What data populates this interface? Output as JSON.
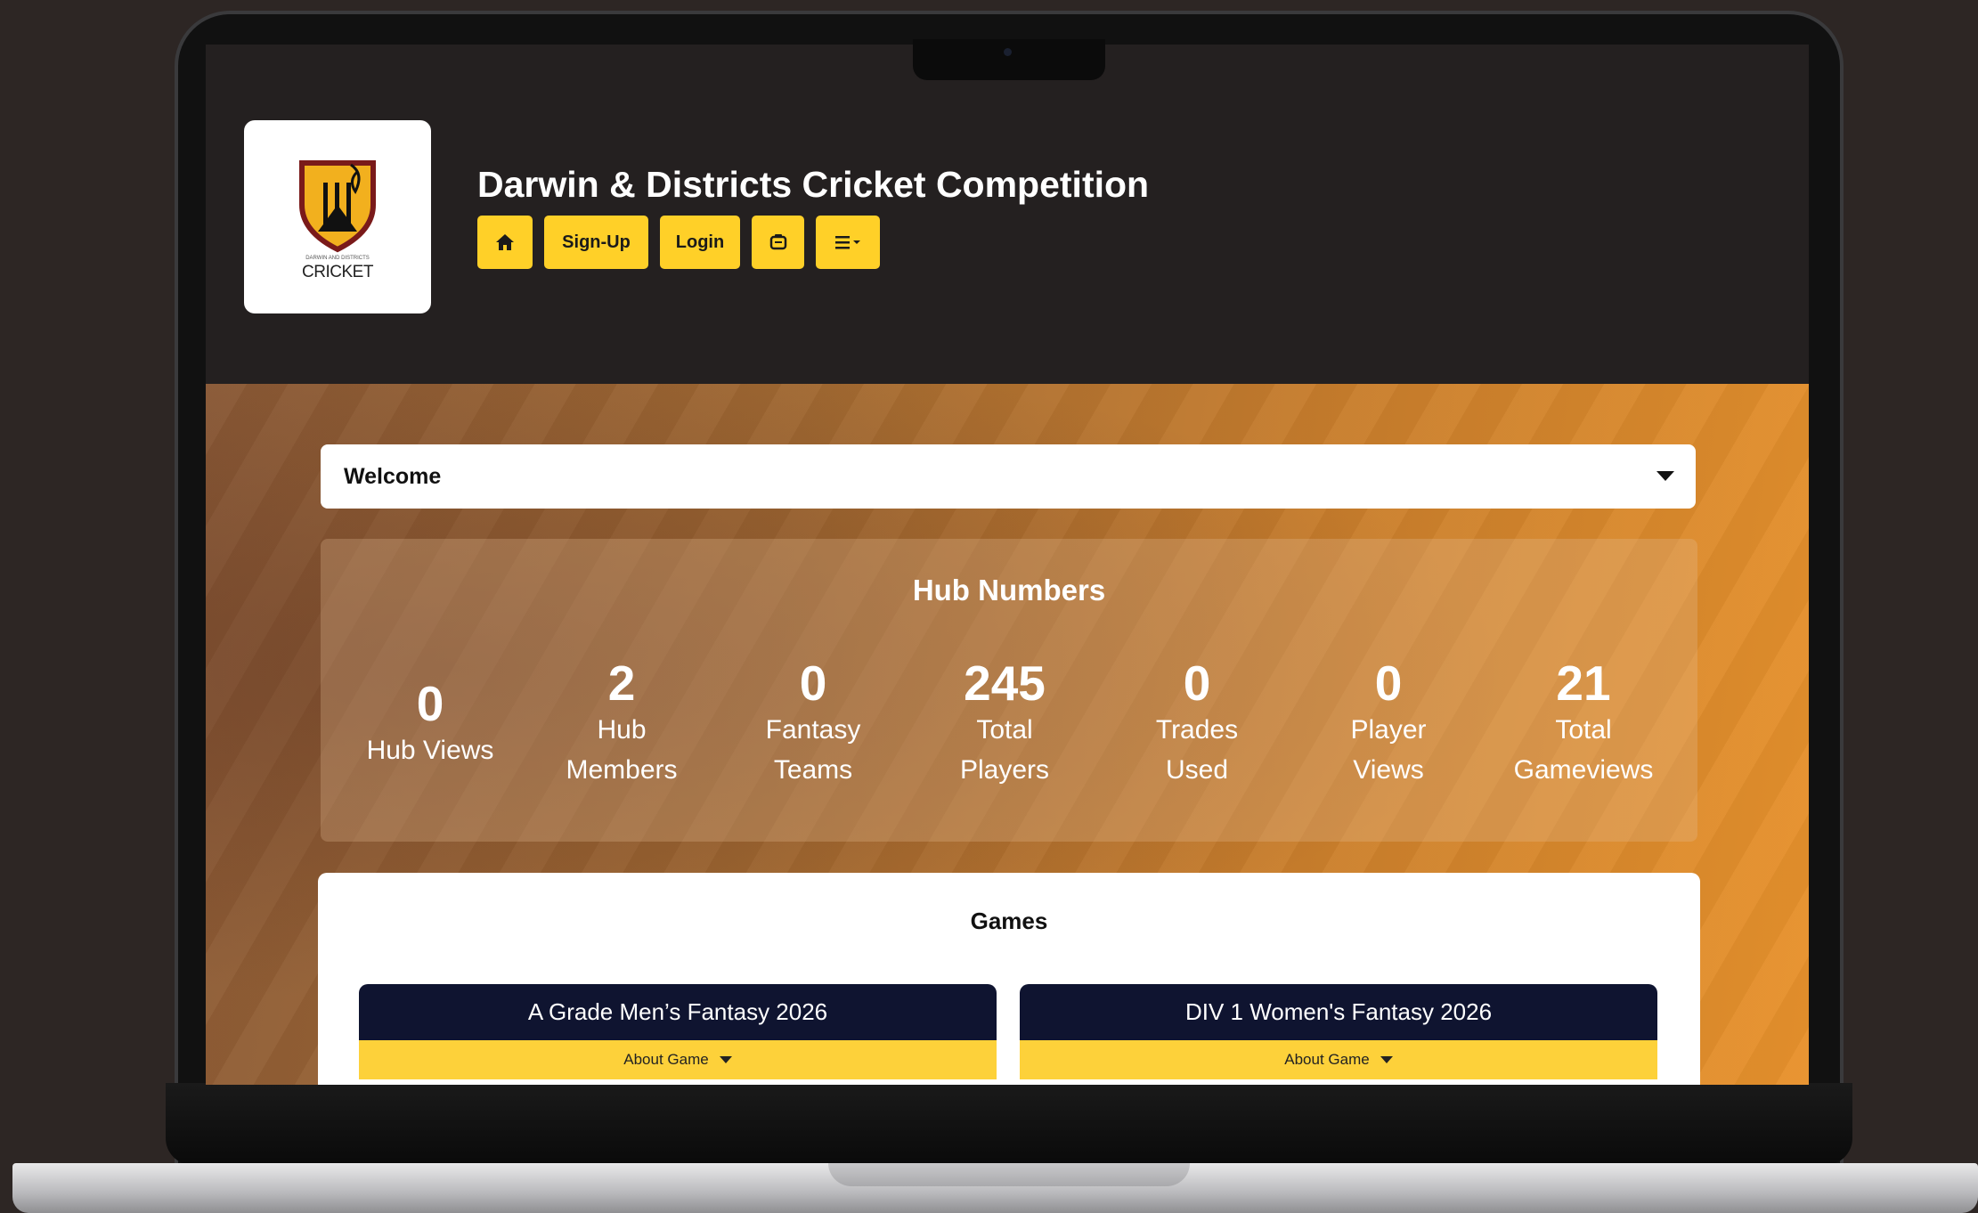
{
  "header": {
    "site_title": "Darwin & Districts Cricket Competition",
    "logo_text": "CRICKET",
    "logo_small_text": "DARWIN AND DISTRICTS",
    "nav": {
      "home_icon": "home-icon",
      "signup_label": "Sign-Up",
      "login_label": "Login",
      "message_icon": "message-icon",
      "menu_icon": "menu-icon"
    }
  },
  "welcome": {
    "label": "Welcome"
  },
  "hub_numbers": {
    "title": "Hub Numbers",
    "stats": [
      {
        "value": "0",
        "label": "Hub Views"
      },
      {
        "value": "2",
        "label": "Hub Members"
      },
      {
        "value": "0",
        "label": "Fantasy Teams"
      },
      {
        "value": "245",
        "label": "Total Players"
      },
      {
        "value": "0",
        "label": "Trades Used"
      },
      {
        "value": "0",
        "label": "Player Views"
      },
      {
        "value": "21",
        "label": "Total Gameviews"
      }
    ]
  },
  "games": {
    "title": "Games",
    "cards": [
      {
        "name": "A Grade Men’s Fantasy 2026",
        "about_label": "About Game"
      },
      {
        "name": "DIV 1 Women's Fantasy 2026",
        "about_label": "About Game"
      }
    ]
  },
  "colors": {
    "accent": "#ffd028",
    "header_bg": "#242020",
    "card_header": "#0f1430",
    "hero_orange": "#e8922c"
  }
}
